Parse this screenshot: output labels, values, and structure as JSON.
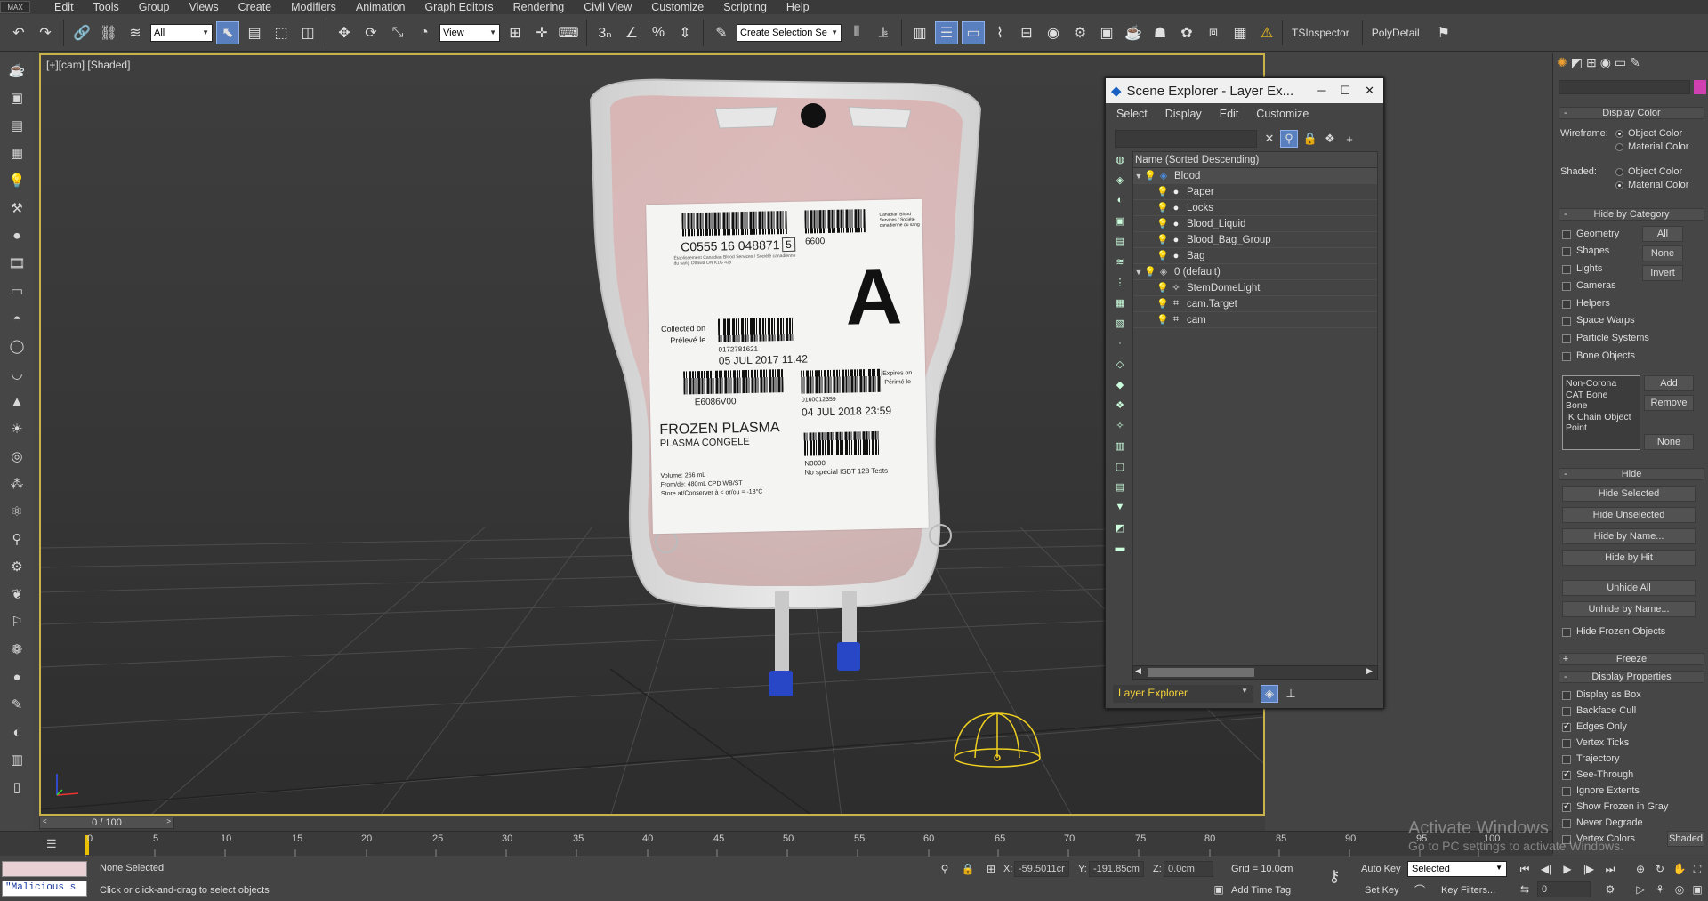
{
  "menubar": {
    "logo": "MAX",
    "items": [
      "Edit",
      "Tools",
      "Group",
      "Views",
      "Create",
      "Modifiers",
      "Animation",
      "Graph Editors",
      "Rendering",
      "Civil View",
      "Customize",
      "Scripting",
      "Help"
    ]
  },
  "toolbar": {
    "filter_select": "All",
    "view_select": "View",
    "selection_set": "Create Selection Se",
    "tsinspector": "TSInspector",
    "polydetail": "PolyDetail"
  },
  "viewport": {
    "label_plus": "[+]",
    "label_cam": "[cam]",
    "label_shaded": "[Shaded]",
    "label": {
      "barcode1_text": "C0555 16 048871",
      "barcode1_check": "5",
      "code_6600": "6600",
      "blood_group": "A",
      "collected_en": "Collected on",
      "collected_fr": "Prélevé le",
      "collect_num": "0172781621",
      "collect_date": "05 JUL 2017 11.42",
      "product_code": "E6086V00",
      "expiry_num": "0160012359",
      "expiry_date": "04 JUL 2018  23:59",
      "expires_en": "Expires on",
      "expires_fr": "Périmé le",
      "product_en": "FROZEN PLASMA",
      "product_fr": "PLASMA CONGELE",
      "n_code": "N0000",
      "special": "No special ISBT 128 Tests",
      "volume": "Volume: 266 mL",
      "from": "From/de: 480mL CPD WB/ST",
      "store": "Store at/Conserver à < or/ou = -18°C",
      "header_small": "Canadian Blood Services / Société canadienne du sang",
      "fine_print": "Établissement Canadian Blood Services / Société canadienne du sang Ottawa ON K1G 4J5"
    }
  },
  "scene_explorer": {
    "title": "Scene Explorer - Layer Ex...",
    "menu": [
      "Select",
      "Display",
      "Edit",
      "Customize"
    ],
    "column_header": "Name (Sorted Descending)",
    "rows": [
      {
        "name": "Blood",
        "indent": 0,
        "type": "layer",
        "expanded": true
      },
      {
        "name": "Paper",
        "indent": 1,
        "type": "object"
      },
      {
        "name": "Locks",
        "indent": 1,
        "type": "object"
      },
      {
        "name": "Blood_Liquid",
        "indent": 1,
        "type": "object"
      },
      {
        "name": "Blood_Bag_Group",
        "indent": 1,
        "type": "object"
      },
      {
        "name": "Bag",
        "indent": 1,
        "type": "object"
      },
      {
        "name": "0 (default)",
        "indent": 0,
        "type": "layer",
        "expanded": true
      },
      {
        "name": "StemDomeLight",
        "indent": 1,
        "type": "light"
      },
      {
        "name": "cam.Target",
        "indent": 1,
        "type": "camera"
      },
      {
        "name": "cam",
        "indent": 1,
        "type": "camera"
      }
    ],
    "footer_select": "Layer Explorer"
  },
  "command_panel": {
    "display_color": {
      "title": "Display Color",
      "wireframe_label": "Wireframe:",
      "shaded_label": "Shaded:",
      "object_color": "Object Color",
      "material_color": "Material Color"
    },
    "hide_by_category": {
      "title": "Hide by Category",
      "items": [
        "Geometry",
        "Shapes",
        "Lights",
        "Cameras",
        "Helpers",
        "Space Warps",
        "Particle Systems",
        "Bone Objects"
      ],
      "btn_all": "All",
      "btn_none": "None",
      "btn_invert": "Invert",
      "list": [
        "Non-Corona",
        "CAT Bone",
        "Bone",
        "IK Chain Object",
        "Point"
      ],
      "btn_add": "Add",
      "btn_remove": "Remove",
      "btn_none2": "None"
    },
    "hide": {
      "title": "Hide",
      "buttons": [
        "Hide Selected",
        "Hide Unselected",
        "Hide by Name...",
        "Hide by Hit",
        "Unhide All",
        "Unhide by Name..."
      ],
      "hide_frozen": "Hide Frozen Objects"
    },
    "freeze": {
      "title": "Freeze"
    },
    "display_properties": {
      "title": "Display Properties",
      "items": [
        {
          "label": "Display as Box",
          "checked": false
        },
        {
          "label": "Backface Cull",
          "checked": false
        },
        {
          "label": "Edges Only",
          "checked": true
        },
        {
          "label": "Vertex Ticks",
          "checked": false
        },
        {
          "label": "Trajectory",
          "checked": false
        },
        {
          "label": "See-Through",
          "checked": true
        },
        {
          "label": "Ignore Extents",
          "checked": false
        },
        {
          "label": "Show Frozen in Gray",
          "checked": true
        },
        {
          "label": "Never Degrade",
          "checked": false
        },
        {
          "label": "Vertex Colors",
          "checked": false
        }
      ],
      "shaded_btn": "Shaded"
    }
  },
  "timeline": {
    "frame": "0 / 100",
    "ticks": [
      "0",
      "5",
      "10",
      "15",
      "20",
      "25",
      "30",
      "35",
      "40",
      "45",
      "50",
      "55",
      "60",
      "65",
      "70",
      "75",
      "80",
      "85",
      "90",
      "95",
      "100"
    ]
  },
  "status": {
    "maxscript": "\"Malicious s",
    "selection": "None Selected",
    "prompt": "Click or click-and-drag to select objects",
    "x_label": "X:",
    "x_value": "-59.5011cr",
    "y_label": "Y:",
    "y_value": "-191.85cm",
    "z_label": "Z:",
    "z_value": "0.0cm",
    "grid": "Grid = 10.0cm",
    "add_time_tag": "Add Time Tag",
    "auto_key": "Auto Key",
    "set_key": "Set Key",
    "key_select": "Selected",
    "key_filters": "Key Filters...",
    "frame_field": "0"
  },
  "watermark": {
    "line1": "Activate Windows",
    "line2": "Go to PC settings to activate Windows."
  }
}
